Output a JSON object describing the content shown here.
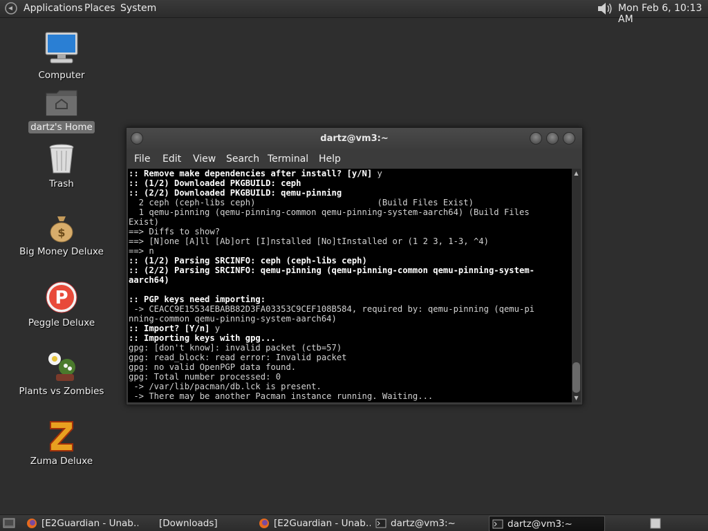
{
  "top_panel": {
    "menus": [
      "Applications",
      "Places",
      "System"
    ],
    "clock": "Mon Feb  6, 10:13 AM",
    "icons": {
      "logo": "gnome-foot-icon",
      "volume": "speaker-volume-icon"
    }
  },
  "desktop_icons": [
    {
      "label": "Computer",
      "icon": "computer-icon"
    },
    {
      "label": "dartz's Home",
      "icon": "home-folder-icon",
      "selected": true
    },
    {
      "label": "Trash",
      "icon": "trash-icon"
    },
    {
      "label": "Big Money Deluxe",
      "icon": "money-bag-icon"
    },
    {
      "label": "Peggle Deluxe",
      "icon": "peggle-icon"
    },
    {
      "label": "Plants vs Zombies",
      "icon": "plants-vs-zombies-icon"
    },
    {
      "label": "Zuma Deluxe",
      "icon": "zuma-icon"
    }
  ],
  "terminal": {
    "title": "dartz@vm3:~",
    "menu": [
      "File",
      "Edit",
      "View",
      "Search",
      "Terminal",
      "Help"
    ],
    "lines": [
      {
        "text": ":: Remove make dependencies after install? [y/N] ",
        "suffix": "y",
        "bold": true
      },
      {
        "text": ":: (1/2) Downloaded PKGBUILD: ceph",
        "bold": true
      },
      {
        "text": ":: (2/2) Downloaded PKGBUILD: qemu-pinning",
        "bold": true
      },
      {
        "text": "  2 ceph (ceph-libs ceph)                        (Build Files Exist)"
      },
      {
        "text": "  1 qemu-pinning (qemu-pinning-common qemu-pinning-system-aarch64) (Build Files"
      },
      {
        "text": "Exist)"
      },
      {
        "text": "==> Diffs to show?"
      },
      {
        "text": "==> [N]one [A]ll [Ab]ort [I]nstalled [No]tInstalled or (1 2 3, 1-3, ^4)"
      },
      {
        "text": "==> n"
      },
      {
        "text": ":: (1/2) Parsing SRCINFO: ceph (ceph-libs ceph)",
        "bold": true
      },
      {
        "text": ":: (2/2) Parsing SRCINFO: qemu-pinning (qemu-pinning-common qemu-pinning-system-",
        "bold": true
      },
      {
        "text": "aarch64)",
        "bold": true
      },
      {
        "text": ""
      },
      {
        "text": ":: PGP keys need importing:",
        "bold": true
      },
      {
        "text": " -> CEACC9E15534EBABB82D3FA03353C9CEF108B584, required by: qemu-pinning (qemu-pi"
      },
      {
        "text": "nning-common qemu-pinning-system-aarch64)"
      },
      {
        "text": ":: Import? [Y/n] ",
        "suffix": "y",
        "bold": true
      },
      {
        "text": ":: Importing keys with gpg...",
        "bold": true
      },
      {
        "text": "gpg: [don't know]: invalid packet (ctb=57)"
      },
      {
        "text": "gpg: read_block: read error: Invalid packet"
      },
      {
        "text": "gpg: no valid OpenPGP data found."
      },
      {
        "text": "gpg: Total number processed: 0"
      },
      {
        "text": " -> /var/lib/pacman/db.lck is present."
      },
      {
        "text": " -> There may be another Pacman instance running. Waiting..."
      }
    ]
  },
  "taskbar": {
    "items": [
      {
        "label": "[E2Guardian - Unab…",
        "icon": "firefox-icon"
      },
      {
        "label": "[Downloads]",
        "icon": "folder-icon"
      },
      {
        "label": "[E2Guardian - Unab…",
        "icon": "firefox-icon"
      },
      {
        "label": "dartz@vm3:~",
        "icon": "terminal-icon"
      },
      {
        "label": "dartz@vm3:~",
        "icon": "terminal-icon",
        "active": true
      }
    ]
  }
}
